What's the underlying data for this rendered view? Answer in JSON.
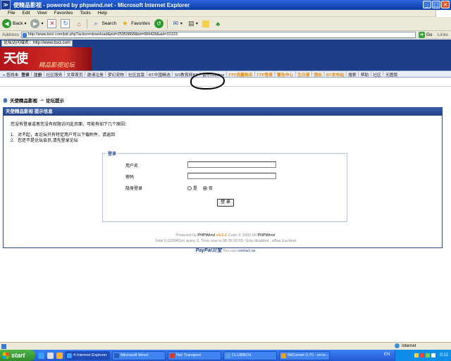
{
  "window": {
    "title": "使精品影视 - powered by phpwind.net - Microsoft Internet Explorer",
    "logo_glyph": "≫",
    "min": "_",
    "max": "□",
    "close": "×"
  },
  "menu": [
    "File",
    "Edit",
    "View",
    "Favorites",
    "Tools",
    "Help"
  ],
  "toolbar": {
    "back": "Back",
    "search": "Search",
    "favorites": "Favorites"
  },
  "address": {
    "label": "Address",
    "url": "http://www.tsxz.com/job.php?action=download&pid=25950868&tid=984428&aid=31223",
    "go": "Go",
    "links": "Links"
  },
  "banner": {
    "site_domain": "论坛访问域名：http://www.tsxz.com",
    "logo_big": "天使",
    "logo_sub": "精品影视论坛"
  },
  "nav": {
    "prefix": "» 您尚未",
    "items": [
      {
        "label": "登录",
        "style": "b"
      },
      {
        "label": "注册",
        "style": "b"
      },
      {
        "label": "社区服务",
        "style": ""
      },
      {
        "label": "文章首页",
        "style": ""
      },
      {
        "label": "邀请注册",
        "style": ""
      },
      {
        "label": "梦幻宠物",
        "style": ""
      },
      {
        "label": "社区盆栽",
        "style": ""
      },
      {
        "label": "BT中国精选",
        "style": ""
      },
      {
        "label": "SO教育网BT",
        "style": ""
      },
      {
        "label": "音乐clubbox",
        "style": ""
      },
      {
        "label": "FTP流量购买",
        "style": "hot"
      },
      {
        "label": "FTP登录",
        "style": "hot"
      },
      {
        "label": "警告中心",
        "style": "hot"
      },
      {
        "label": "生日报",
        "style": "hot"
      },
      {
        "label": "银台",
        "style": "hot"
      },
      {
        "label": "BT发布站",
        "style": "hot"
      },
      {
        "label": "搜索",
        "style": ""
      },
      {
        "label": "帮助",
        "style": ""
      },
      {
        "label": "社区",
        "style": ""
      },
      {
        "label": "无图版",
        "style": ""
      }
    ]
  },
  "breadcrumb": {
    "home": "天使精品影视",
    "sep": "->",
    "current": "论坛提示"
  },
  "infobox": {
    "header": "天使精品影视  提示信息",
    "message": "您没有登录或者您没有权限访问此页面，可能有如下几个原因：",
    "reasons": [
      {
        "n": "1.",
        "text": "对不起，本论坛只有特定用户可以下载附件，请返回"
      },
      {
        "n": "2.",
        "text": "您还不是论坛会员,请先登录论坛"
      }
    ]
  },
  "login": {
    "legend": "登录",
    "username_label": "用户名",
    "password_label": "密码",
    "hidden_label": "隐身登录",
    "opt_yes": "是",
    "opt_no": "否",
    "submit": "登 录"
  },
  "footer": {
    "line1_a": "Powered by",
    "line1_b": "PHPWind",
    "line1_ver": "v4.3.2",
    "line1_c": "Code © 2003-06",
    "line1_d": "PHPWind",
    "line2": "Total 0.033942(s) query 2, Time now is:08-26 00:55, Gzip disabled , eBay Eachnet",
    "paypal": "PayPal贝宝",
    "paypal_suffix": "You can",
    "contact": "contact us"
  },
  "status": {
    "zone": "Internet"
  },
  "taskbar": {
    "start": "start",
    "tasks": [
      {
        "label": "4 Internet Explorer",
        "color": "#3aa0ff",
        "active": true
      },
      {
        "label": "Microsoft Word",
        "color": "#2b5bb8",
        "active": false
      },
      {
        "label": "Net Transport",
        "color": "#d83a2a",
        "active": false
      },
      {
        "label": "CLUBBOX",
        "color": "#5aa0e0",
        "active": false
      },
      {
        "label": "BitComet 0.70 - error...",
        "color": "#e7a023",
        "active": false
      }
    ],
    "lang": "EN",
    "clock": "0:12"
  }
}
